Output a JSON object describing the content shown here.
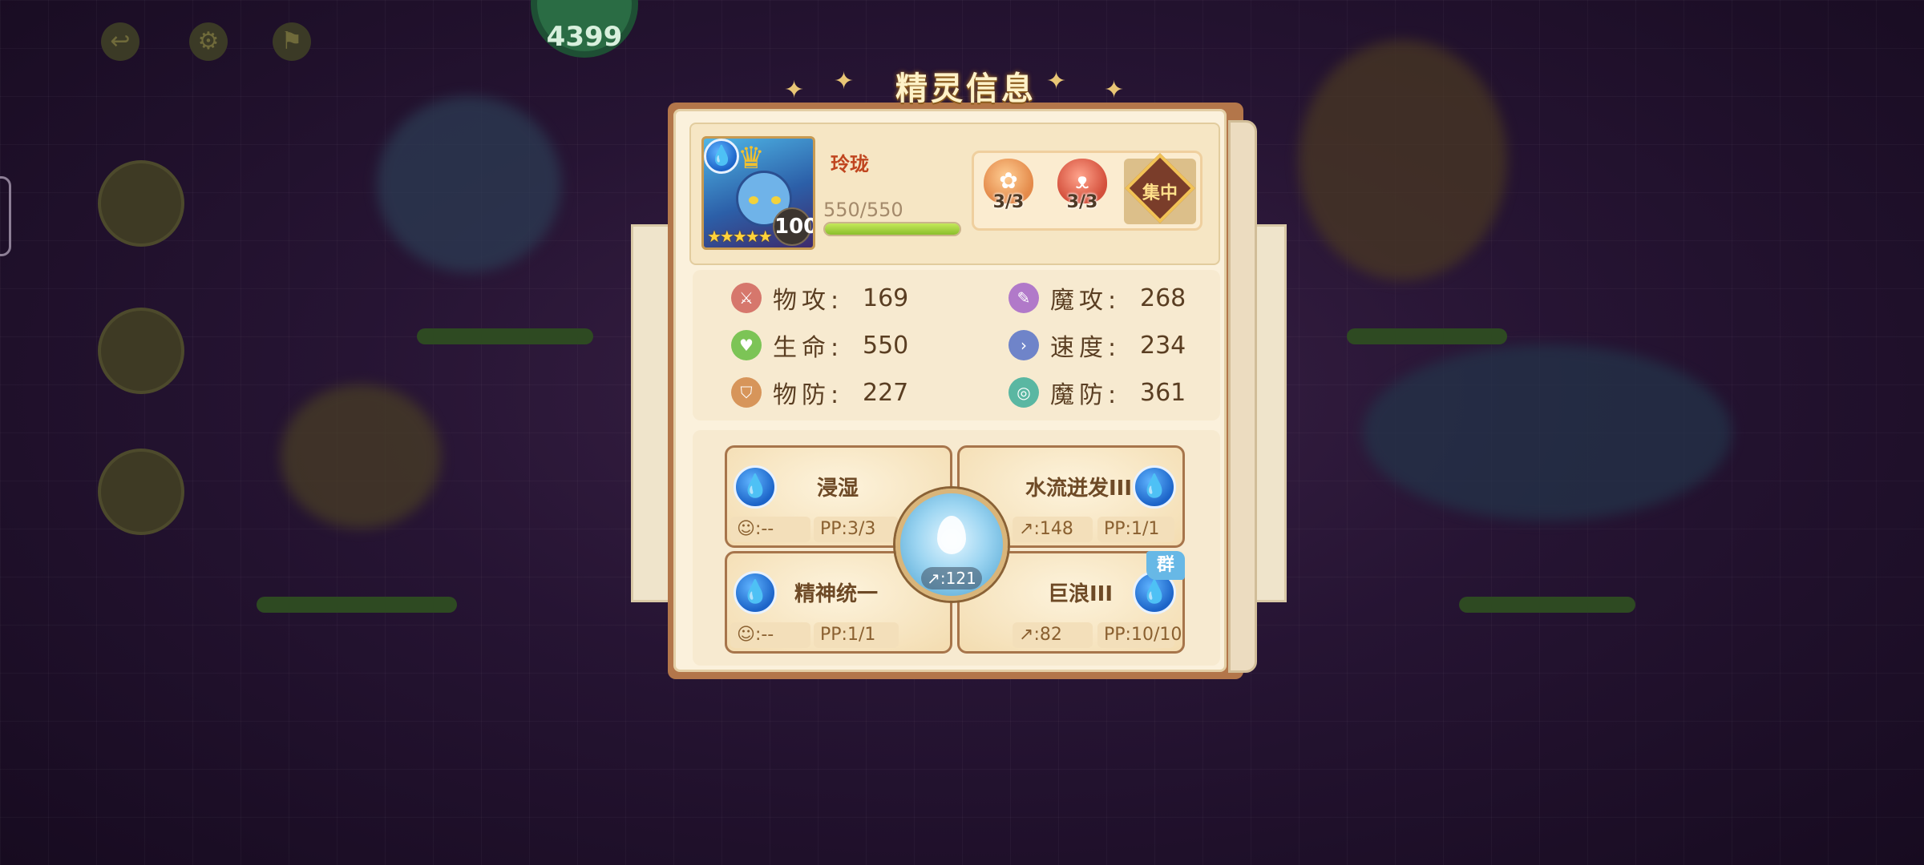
{
  "background": {
    "badge_text": "4399"
  },
  "dialog": {
    "title": "精灵信息"
  },
  "pet": {
    "name": "玲珑",
    "level": "100",
    "hp_text": "550/550",
    "hp_fraction": 1.0,
    "stars": "★★★★★",
    "element_icon": "water-drop-icon",
    "traits": [
      {
        "icon": "shell-icon",
        "count": "3/3"
      },
      {
        "icon": "cat-mask-icon",
        "count": "3/3"
      }
    ],
    "personality": "集中"
  },
  "stats": {
    "phys_attack": {
      "label": "物攻:",
      "value": "169"
    },
    "magic_attack": {
      "label": "魔攻:",
      "value": "268"
    },
    "hp": {
      "label": "生命:",
      "value": "550"
    },
    "speed": {
      "label": "速度:",
      "value": "234"
    },
    "phys_defense": {
      "label": "物防:",
      "value": "227"
    },
    "magic_defense": {
      "label": "魔防:",
      "value": "361"
    }
  },
  "skills": [
    {
      "name": "浸湿",
      "power": ":--",
      "pp": "PP:3/3",
      "group": ""
    },
    {
      "name": "水流迸发III",
      "power": ":148",
      "pp": "PP:1/1",
      "group": ""
    },
    {
      "name": "精神统一",
      "power": ":--",
      "pp": "PP:1/1",
      "group": ""
    },
    {
      "name": "巨浪III",
      "power": ":82",
      "pp": "PP:10/10",
      "group": "群"
    }
  ],
  "special_skill": {
    "value": ":121"
  },
  "colors": {
    "background": "#261433",
    "panel": "#fbf1dc",
    "name_red": "#c0451f",
    "hp_green": "#8bbe2c",
    "text_brown": "#5a3e22"
  }
}
